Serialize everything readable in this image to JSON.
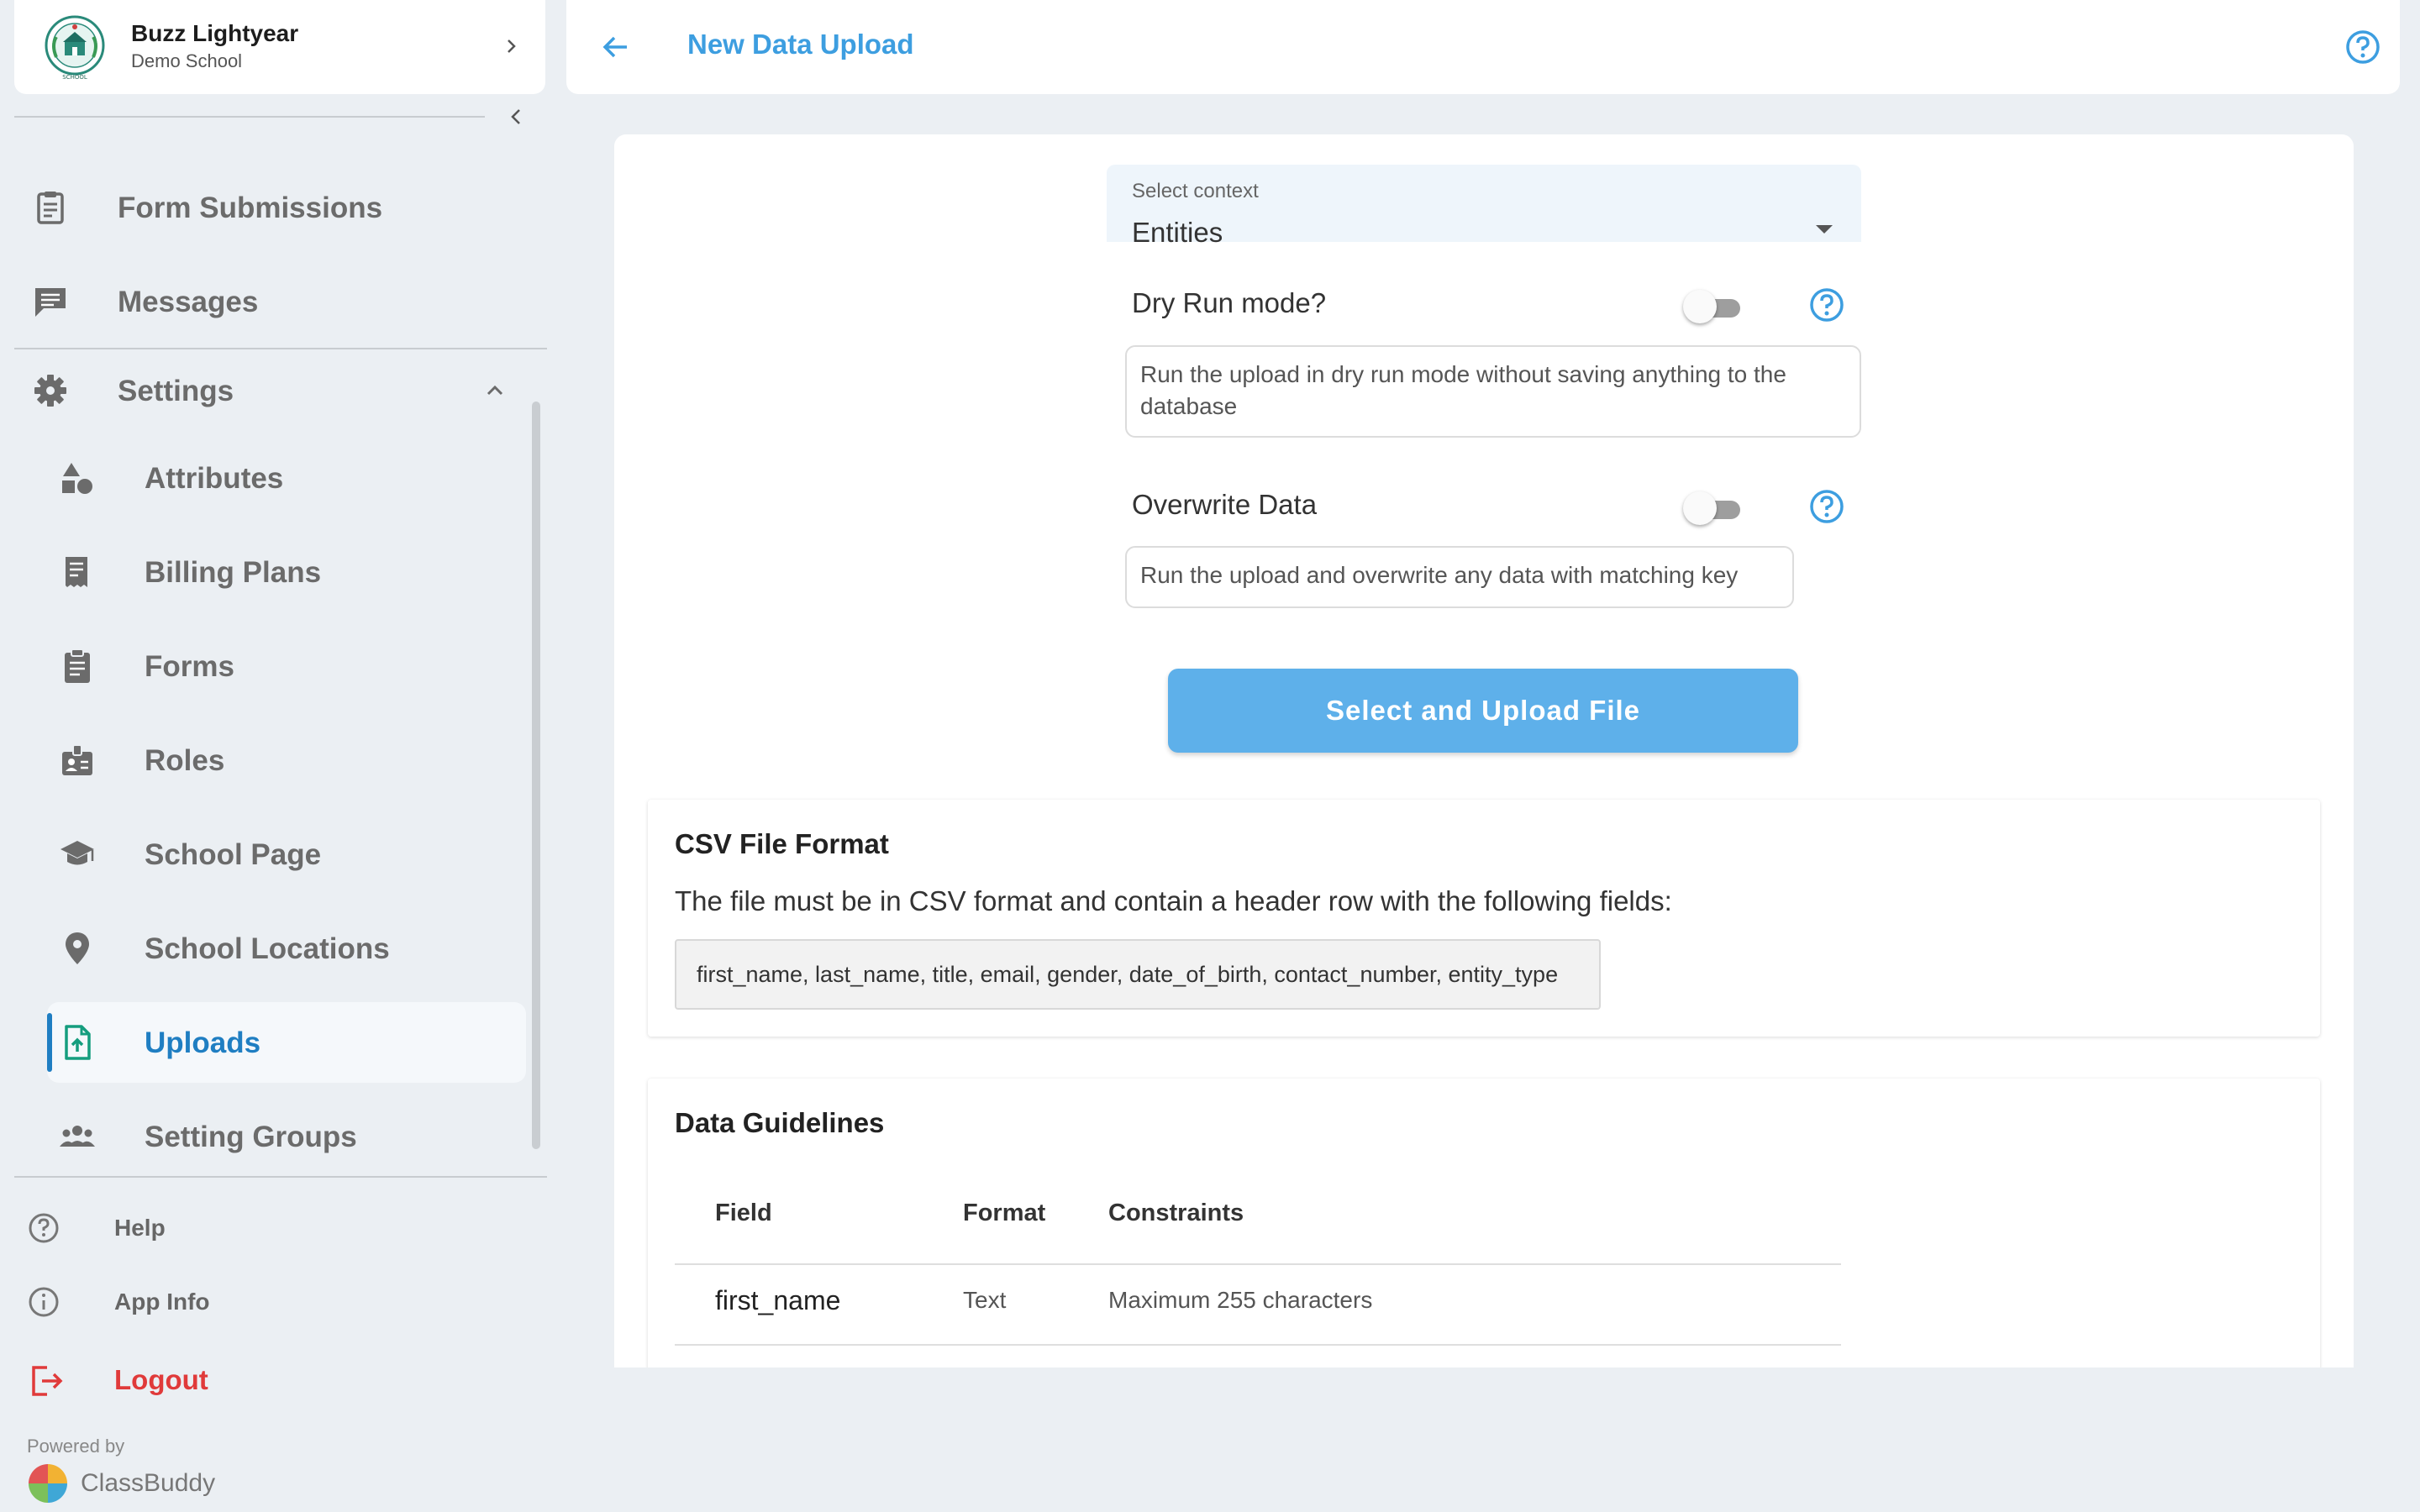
{
  "profile": {
    "name": "Buzz Lightyear",
    "school": "Demo School"
  },
  "nav": {
    "top": [
      {
        "label": "Form Submissions",
        "icon": "clipboard-list-icon"
      },
      {
        "label": "Messages",
        "icon": "message-icon"
      }
    ],
    "settings": {
      "label": "Settings",
      "icon": "gear-icon",
      "expanded": true
    },
    "sub": [
      {
        "label": "Attributes",
        "icon": "shapes-icon"
      },
      {
        "label": "Billing Plans",
        "icon": "receipt-icon"
      },
      {
        "label": "Forms",
        "icon": "clipboard-icon"
      },
      {
        "label": "Roles",
        "icon": "badge-icon"
      },
      {
        "label": "School Page",
        "icon": "graduation-cap-icon"
      },
      {
        "label": "School Locations",
        "icon": "map-pin-icon"
      },
      {
        "label": "Uploads",
        "icon": "file-upload-icon",
        "active": true
      },
      {
        "label": "Setting Groups",
        "icon": "group-icon"
      }
    ],
    "footer": [
      {
        "label": "Help",
        "icon": "help-circle-icon"
      },
      {
        "label": "App Info",
        "icon": "info-circle-icon"
      },
      {
        "label": "Logout",
        "icon": "logout-icon"
      }
    ],
    "powered_by": "Powered by",
    "brand": "ClassBuddy"
  },
  "header": {
    "title": "New Data Upload"
  },
  "form": {
    "context": {
      "label": "Select context",
      "value": "Entities"
    },
    "dry_run": {
      "label": "Dry Run mode?",
      "enabled": false,
      "description": "Run the upload in dry run mode without saving anything to the database"
    },
    "overwrite": {
      "label": "Overwrite Data",
      "enabled": false,
      "description": "Run the upload and overwrite any data with matching key"
    },
    "upload_button": "Select and Upload File"
  },
  "csv_format": {
    "title": "CSV File Format",
    "text": "The file must be in CSV format and contain a header row with the following fields:",
    "fields": "first_name, last_name, title, email, gender, date_of_birth, contact_number, entity_type"
  },
  "guidelines": {
    "title": "Data Guidelines",
    "columns": [
      "Field",
      "Format",
      "Constraints"
    ],
    "rows": [
      {
        "field": "first_name",
        "format": "Text",
        "constraints": "Maximum 255 characters"
      }
    ]
  },
  "colors": {
    "accent": "#3d9ee0",
    "active_nav": "#1f7ec2",
    "logout": "#e03a3a",
    "button": "#5eb0ea"
  }
}
